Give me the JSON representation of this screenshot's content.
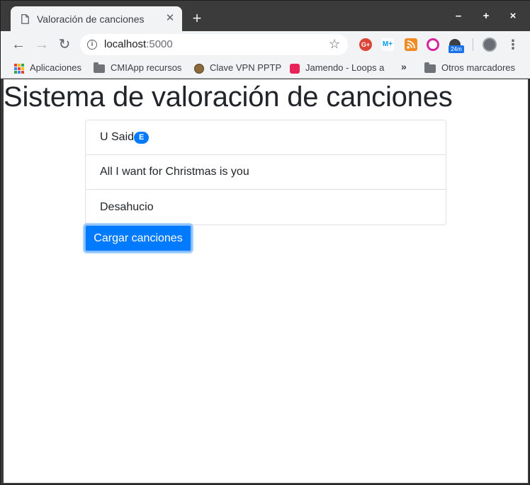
{
  "browser": {
    "tab_title": "Valoración de canciones",
    "new_tab_label": "+",
    "window_controls": {
      "minimize": "–",
      "maximize": "+",
      "close": "×"
    },
    "omnibox": {
      "host": "localhost",
      "port": ":5000"
    },
    "extensions": [
      {
        "name": "google-plus-icon",
        "label": "G+",
        "color": "#db4437"
      },
      {
        "name": "movistar-icon",
        "label": "M+",
        "color": "#019df4"
      },
      {
        "name": "rss-icon",
        "label": "",
        "color": "#f28a24"
      },
      {
        "name": "instagram-icon",
        "label": "",
        "color": "#d6249f"
      },
      {
        "name": "timer-icon",
        "label": "",
        "color": "#3c4043"
      }
    ],
    "extension_badge": "24m"
  },
  "bookmarks": {
    "apps": "Aplicaciones",
    "items": [
      "CMIApp recursos",
      "Clave VPN PPTP",
      "Jamendo - Loops a"
    ],
    "overflow": "»",
    "other": "Otros marcadores"
  },
  "page": {
    "title": "Sistema de valoración de canciones",
    "songs": [
      {
        "name": "U Said",
        "badge": "E"
      },
      {
        "name": "All I want for Christmas is you",
        "badge": null
      },
      {
        "name": "Desahucio",
        "badge": null
      }
    ],
    "load_button": "Cargar canciones"
  }
}
